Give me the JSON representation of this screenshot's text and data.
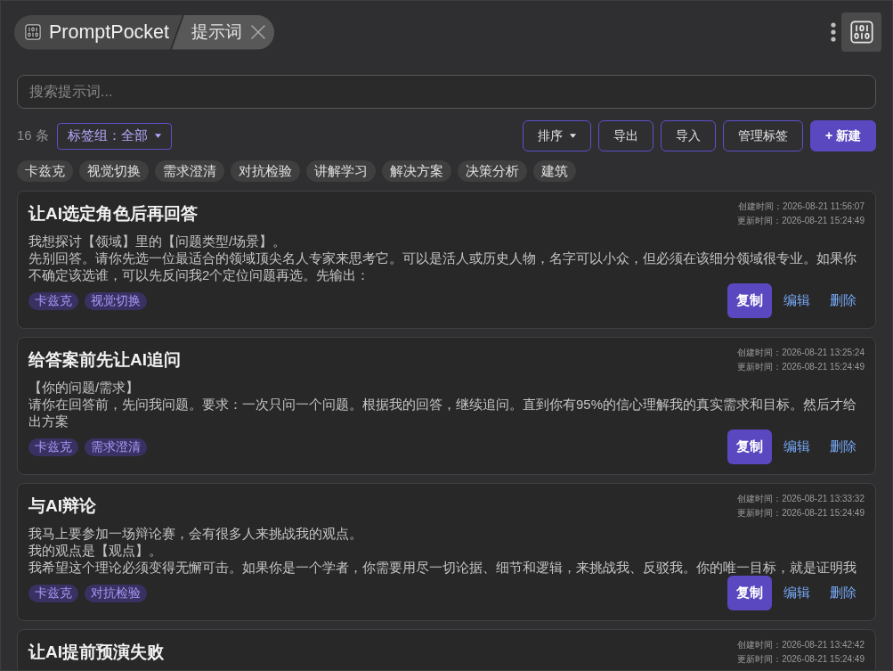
{
  "header": {
    "tabs": [
      {
        "kind": "app",
        "label": "PromptPocket"
      },
      {
        "kind": "page",
        "label": "提示词"
      }
    ]
  },
  "search": {
    "placeholder": "搜索提示词..."
  },
  "toolbar": {
    "count": "16 条",
    "tag_group": "标签组：全部",
    "buttons": [
      {
        "kind": "dropdown",
        "label": "排序"
      },
      {
        "kind": "outline",
        "label": "导出"
      },
      {
        "kind": "outline",
        "label": "导入"
      },
      {
        "kind": "outline",
        "label": "管理标签"
      },
      {
        "kind": "primary",
        "label": "+ 新建"
      }
    ]
  },
  "tag_filters": [
    {
      "label": "卡兹克",
      "selected": false
    },
    {
      "label": "视觉切换",
      "selected": false
    },
    {
      "label": "需求澄清",
      "selected": false
    },
    {
      "label": "对抗检验",
      "selected": false
    },
    {
      "label": "讲解学习",
      "selected": false
    },
    {
      "label": "解决方案",
      "selected": false
    },
    {
      "label": "决策分析",
      "selected": false
    },
    {
      "label": "建筑",
      "selected": false
    }
  ],
  "prompts": [
    {
      "title": "让AI选定角色后再回答",
      "created": "创建时间：2026-08-21 11:56:07",
      "updated": "更新时间：2026-08-21 15:24:49",
      "paragraphs": [
        "我想探讨【领域】里的【问题类型/场景】。",
        "先别回答。请你先选一位最适合的领域顶尖名人专家来思考它。可以是活人或历史人物，名字可以小众，但必须在该细分领域很专业。如果你不确定该选谁，可以先反问我2个定位问题再选。先输出："
      ],
      "tags": [
        "卡兹克",
        "视觉切换"
      ],
      "actions": [
        {
          "kind": "primary",
          "label": "复制"
        },
        {
          "kind": "link",
          "label": "编辑"
        },
        {
          "kind": "link",
          "label": "删除"
        }
      ]
    },
    {
      "title": "给答案前先让AI追问",
      "created": "创建时间：2026-08-21 13:25:24",
      "updated": "更新时间：2026-08-21 15:24:49",
      "paragraphs": [
        "【你的问题/需求】",
        "请你在回答前，先问我问题。要求：一次只问一个问题。根据我的回答，继续追问。直到你有95%的信心理解我的真实需求和目标。然后才给出方案"
      ],
      "tags": [
        "卡兹克",
        "需求澄清"
      ],
      "actions": [
        {
          "kind": "primary",
          "label": "复制"
        },
        {
          "kind": "link",
          "label": "编辑"
        },
        {
          "kind": "link",
          "label": "删除"
        }
      ]
    },
    {
      "title": "与AI辩论",
      "created": "创建时间：2026-08-21 13:33:32",
      "updated": "更新时间：2026-08-21 15:24:49",
      "paragraphs": [
        "我马上要参加一场辩论赛，会有很多人来挑战我的观点。",
        "我的观点是【观点】。",
        "我希望这个理论必须变得无懈可击。如果你是一个学者，你需要用尽一切论据、细节和逻辑，来挑战我、反驳我。你的唯一目标，就是证明我"
      ],
      "tags": [
        "卡兹克",
        "对抗检验"
      ],
      "actions": [
        {
          "kind": "primary",
          "label": "复制"
        },
        {
          "kind": "link",
          "label": "编辑"
        },
        {
          "kind": "link",
          "label": "删除"
        }
      ]
    },
    {
      "title": "让AI提前预演失败",
      "created": "创建时间：2026-08-21 13:42:42",
      "updated": "更新时间：2026-08-21 15:24:49"
    }
  ]
}
